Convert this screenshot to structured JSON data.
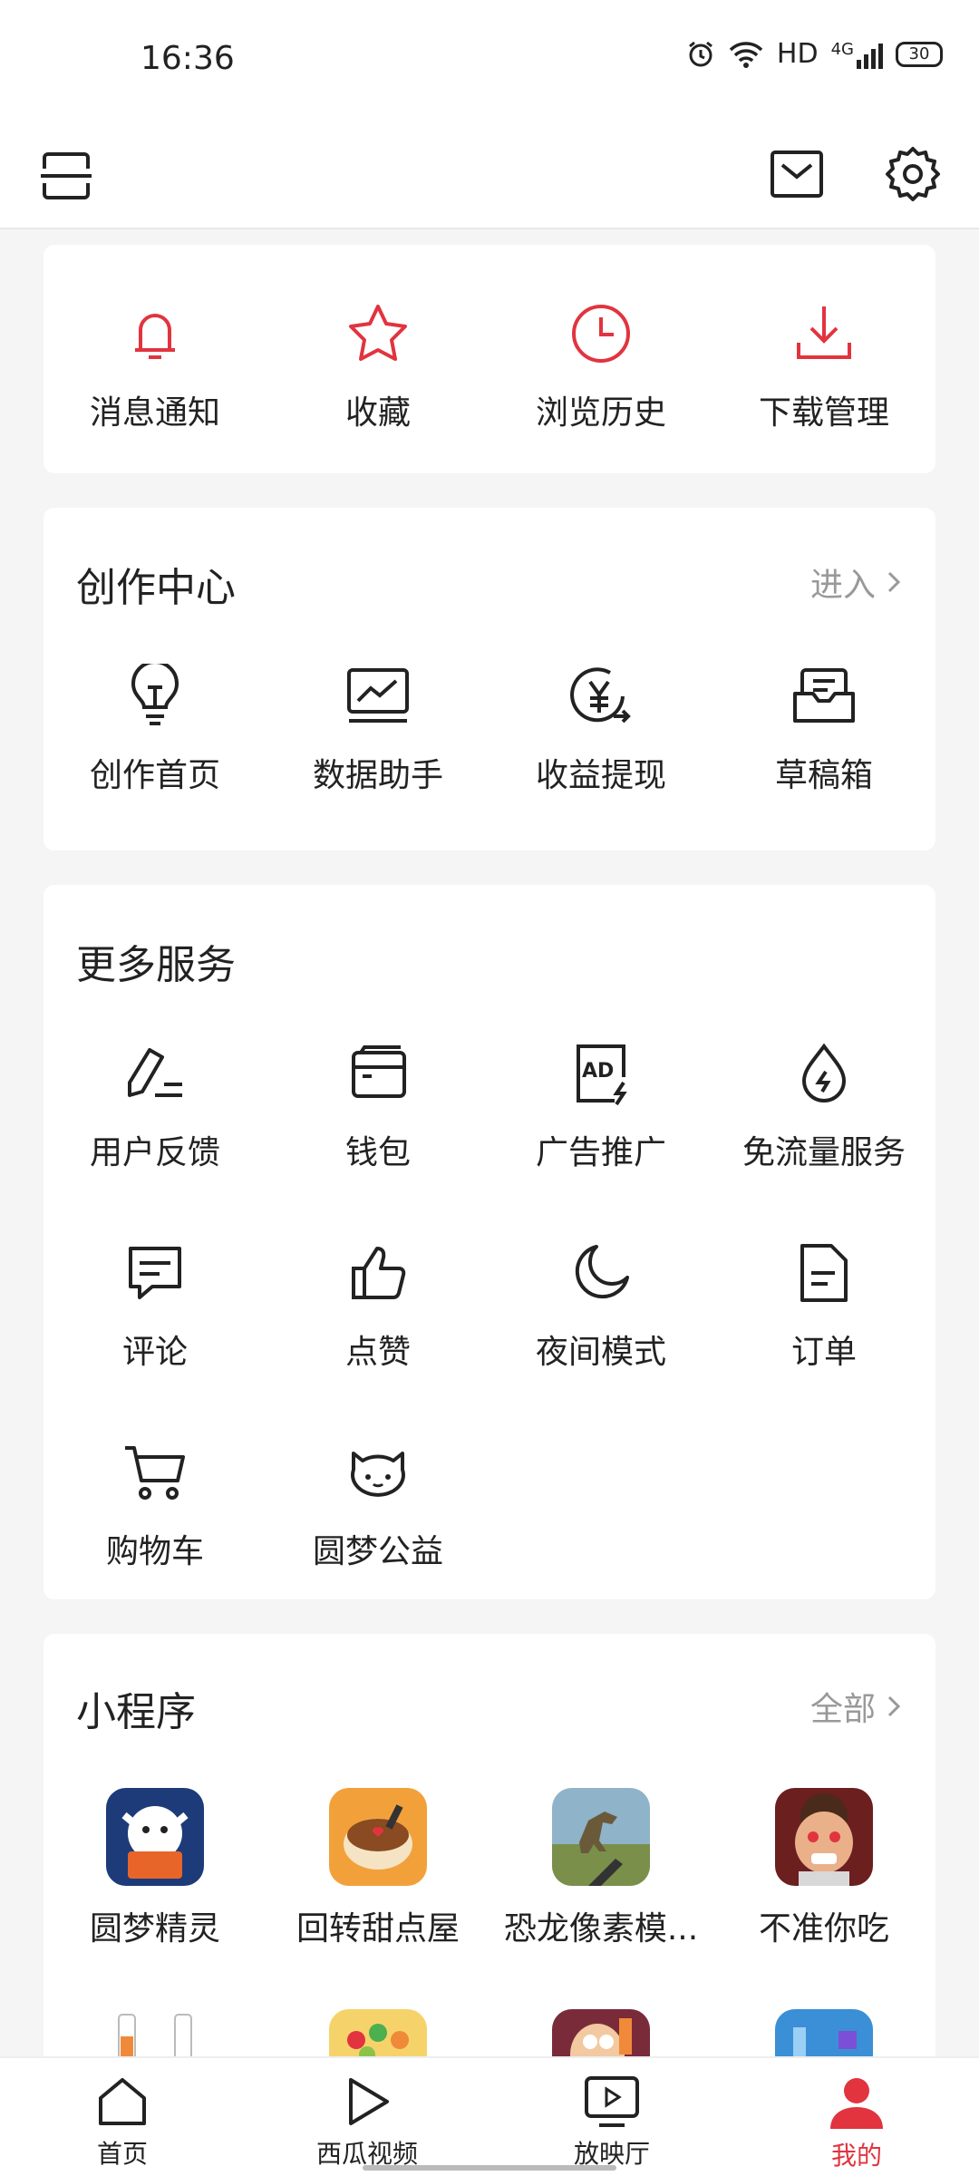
{
  "status_bar": {
    "time": "16:36",
    "network": "HD",
    "signal": "4G",
    "battery": "30"
  },
  "colors": {
    "accent": "#e1343f",
    "icon": "#222222",
    "background": "#f5f5f5"
  },
  "quick_actions": [
    {
      "label": "消息通知",
      "icon": "bell-icon"
    },
    {
      "label": "收藏",
      "icon": "star-icon"
    },
    {
      "label": "浏览历史",
      "icon": "clock-icon"
    },
    {
      "label": "下载管理",
      "icon": "download-icon"
    }
  ],
  "creator_center": {
    "title": "创作中心",
    "link": "进入",
    "items": [
      {
        "label": "创作首页",
        "icon": "lightbulb-icon"
      },
      {
        "label": "数据助手",
        "icon": "chart-icon"
      },
      {
        "label": "收益提现",
        "icon": "yen-withdraw-icon"
      },
      {
        "label": "草稿箱",
        "icon": "inbox-icon"
      }
    ]
  },
  "more_services": {
    "title": "更多服务",
    "items": [
      {
        "label": "用户反馈",
        "icon": "pencil-icon"
      },
      {
        "label": "钱包",
        "icon": "wallet-icon"
      },
      {
        "label": "广告推广",
        "icon": "ad-icon"
      },
      {
        "label": "免流量服务",
        "icon": "droplet-icon"
      },
      {
        "label": "评论",
        "icon": "comment-icon"
      },
      {
        "label": "点赞",
        "icon": "thumbs-up-icon"
      },
      {
        "label": "夜间模式",
        "icon": "moon-icon"
      },
      {
        "label": "订单",
        "icon": "document-icon"
      },
      {
        "label": "购物车",
        "icon": "cart-icon"
      },
      {
        "label": "圆梦公益",
        "icon": "charity-face-icon"
      }
    ]
  },
  "mini_programs": {
    "title": "小程序",
    "link": "全部",
    "items": [
      {
        "label": "圆梦精灵",
        "icon": "dream-sprite-app-icon"
      },
      {
        "label": "回转甜点屋",
        "icon": "dessert-app-icon"
      },
      {
        "label": "恐龙像素模...",
        "icon": "dinosaur-app-icon"
      },
      {
        "label": "不准你吃",
        "icon": "angry-man-app-icon"
      }
    ]
  },
  "bottom_nav": [
    {
      "label": "首页",
      "icon": "home-icon"
    },
    {
      "label": "西瓜视频",
      "icon": "play-icon"
    },
    {
      "label": "放映厅",
      "icon": "tv-play-icon"
    },
    {
      "label": "我的",
      "icon": "profile-icon"
    }
  ]
}
